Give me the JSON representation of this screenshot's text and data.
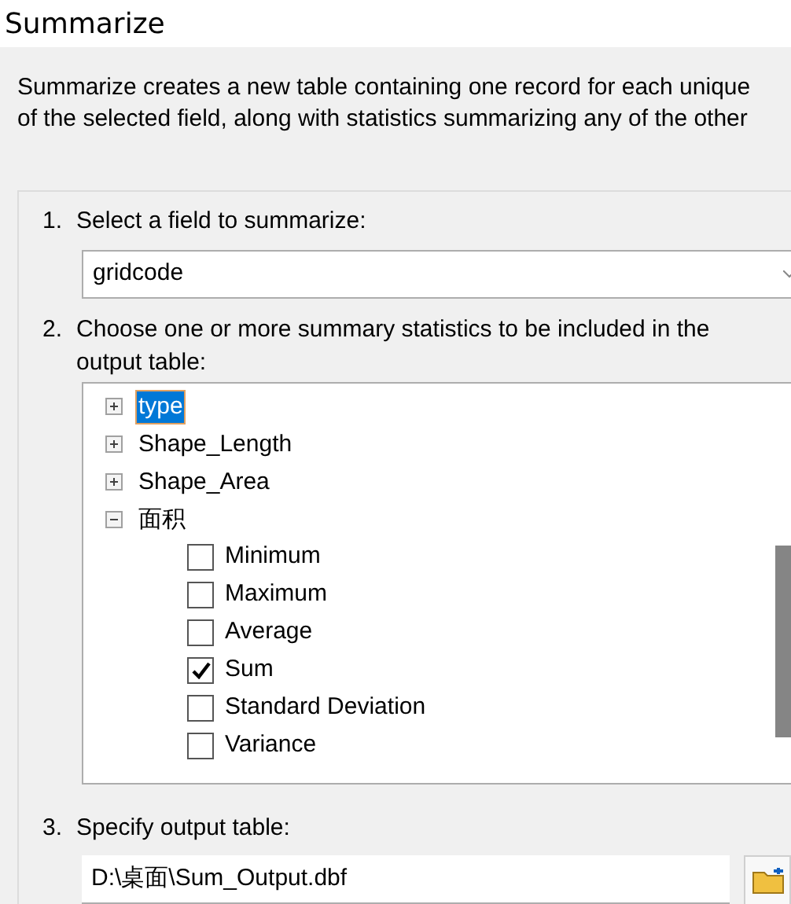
{
  "window": {
    "title": "Summarize"
  },
  "description_lines": [
    "Summarize creates a new table containing one record for each unique",
    "of the selected field, along with statistics summarizing any of the other"
  ],
  "step1": {
    "number": "1.",
    "label": "Select a field to summarize:",
    "dropdown": {
      "value": "gridcode"
    }
  },
  "step2": {
    "number": "2.",
    "label": "Choose one or more summary statistics to be included in the output table:",
    "tree": [
      {
        "label": "type",
        "expanded": false,
        "selected": true
      },
      {
        "label": "Shape_Length",
        "expanded": false,
        "selected": false
      },
      {
        "label": "Shape_Area",
        "expanded": false,
        "selected": false
      },
      {
        "label": "面积",
        "expanded": true,
        "selected": false,
        "children": [
          {
            "label": "Minimum",
            "checked": false
          },
          {
            "label": "Maximum",
            "checked": false
          },
          {
            "label": "Average",
            "checked": false
          },
          {
            "label": "Sum",
            "checked": true
          },
          {
            "label": "Standard Deviation",
            "checked": false
          },
          {
            "label": "Variance",
            "checked": false
          }
        ]
      }
    ]
  },
  "step3": {
    "number": "3.",
    "label": "Specify output table:",
    "output": {
      "value": "D:\\桌面\\Sum_Output.dbf"
    }
  }
}
